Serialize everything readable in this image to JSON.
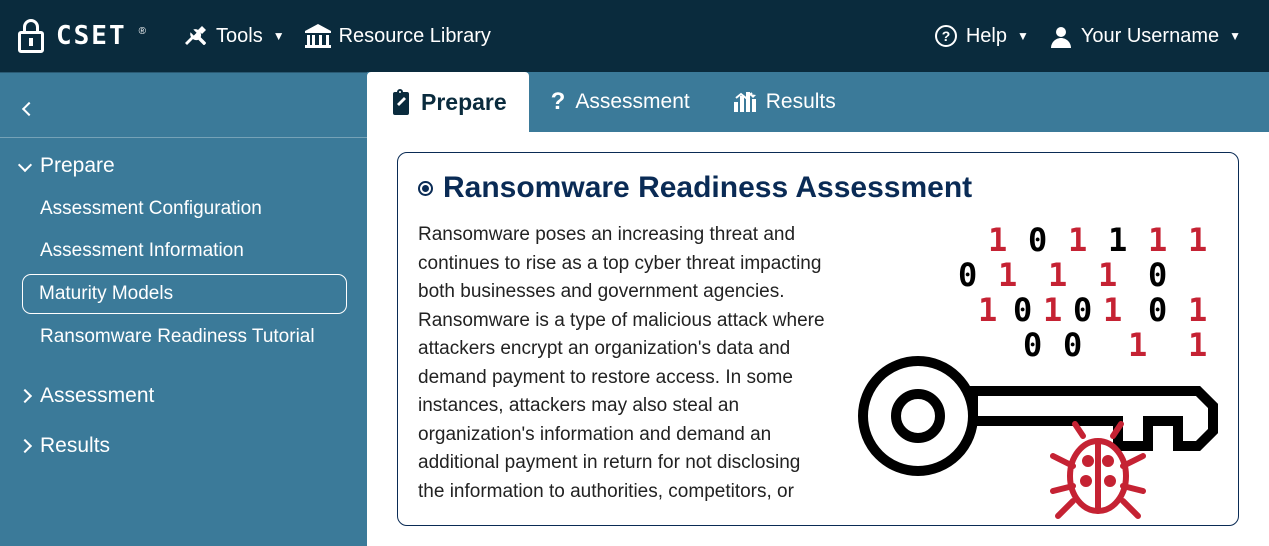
{
  "topbar": {
    "brand": "CSET",
    "tools_label": "Tools",
    "library_label": "Resource Library",
    "help_label": "Help",
    "user_label": "Your Username"
  },
  "sidebar": {
    "groups": [
      {
        "label": "Prepare",
        "expanded": true,
        "items": [
          {
            "label": "Assessment Configuration",
            "active": false
          },
          {
            "label": "Assessment Information",
            "active": false
          },
          {
            "label": "Maturity Models",
            "active": true
          },
          {
            "label": "Ransomware Readiness Tutorial",
            "active": false
          }
        ]
      },
      {
        "label": "Assessment",
        "expanded": false,
        "items": []
      },
      {
        "label": "Results",
        "expanded": false,
        "items": []
      }
    ]
  },
  "tabs": {
    "prepare": "Prepare",
    "assessment": "Assessment",
    "results": "Results",
    "active": "prepare"
  },
  "panel": {
    "title": "Ransomware Readiness Assessment",
    "body": "Ransomware poses an increasing threat and continues to rise as a top cyber threat impacting both businesses and government agencies. Ransomware is a type of malicious attack where attackers encrypt an organization's data and demand payment to restore access. In some instances, attackers may also steal an organization's information and demand an additional payment in return for not disclosing the information to authorities, competitors, or"
  }
}
